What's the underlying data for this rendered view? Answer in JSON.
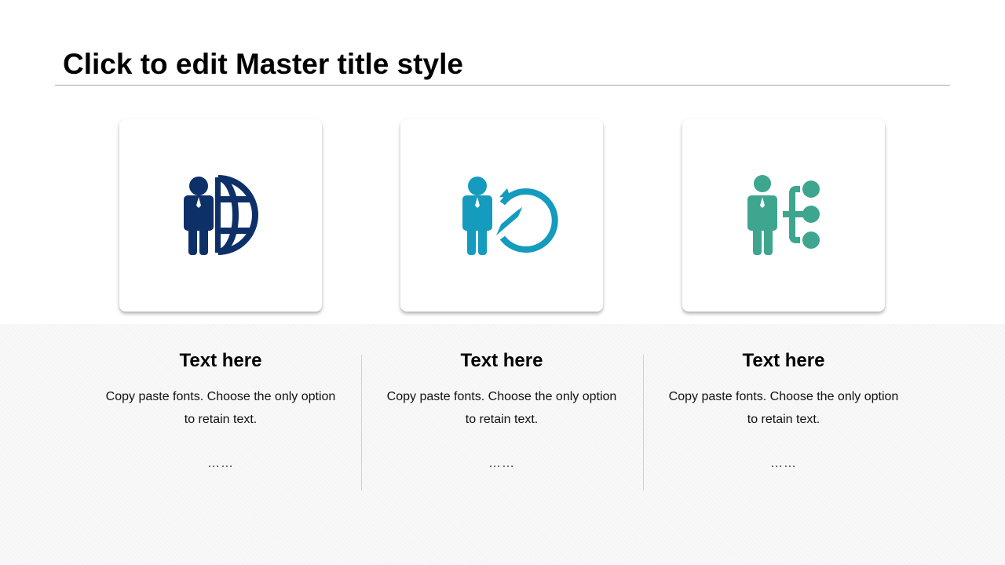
{
  "slide": {
    "title": "Click to edit Master title style"
  },
  "columns": [
    {
      "icon": "businessman-globe-icon",
      "icon_color": "#0e3068",
      "heading": "Text here",
      "body": "Copy paste fonts. Choose the only option to retain text.",
      "dots": "……"
    },
    {
      "icon": "businessman-compass-icon",
      "icon_color": "#149bbd",
      "heading": "Text here",
      "body": "Copy paste fonts. Choose the only option to retain text.",
      "dots": "……"
    },
    {
      "icon": "businessman-hierarchy-icon",
      "icon_color": "#3ea58e",
      "heading": "Text here",
      "body": "Copy paste fonts. Choose the only option to retain text.",
      "dots": "……"
    }
  ]
}
